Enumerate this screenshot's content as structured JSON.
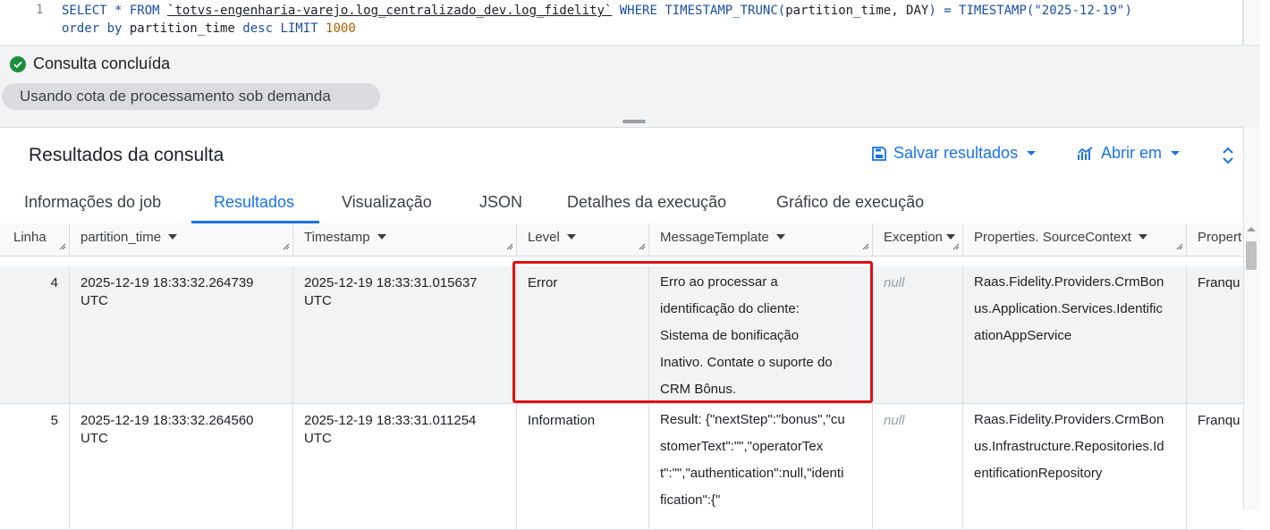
{
  "editor": {
    "line_number": "1",
    "line1": {
      "select": "SELECT * FROM ",
      "table": "`totvs-engenharia-varejo.log_centralizado_dev.log_fidelity`",
      "where": " WHERE TIMESTAMP_TRUNC(",
      "args": "partition_time, DAY",
      "eq": ") = TIMESTAMP(\"2025-12-19\")"
    },
    "line2": {
      "order": "order by ",
      "col": "partition_time",
      "desc": " desc LIMIT ",
      "limit": "1000"
    }
  },
  "status": {
    "message": "Consulta concluída",
    "quota": "Usando cota de processamento sob demanda"
  },
  "results": {
    "title": "Resultados da consulta",
    "save_label": "Salvar resultados",
    "open_label": "Abrir em"
  },
  "tabs": [
    {
      "label": "Informações do job"
    },
    {
      "label": "Resultados"
    },
    {
      "label": "Visualização"
    },
    {
      "label": "JSON"
    },
    {
      "label": "Detalhes da execução"
    },
    {
      "label": "Gráfico de execução"
    }
  ],
  "active_tab": "Resultados",
  "columns": [
    {
      "label": "Linha"
    },
    {
      "label": "partition_time"
    },
    {
      "label": "Timestamp"
    },
    {
      "label": "Level"
    },
    {
      "label": "MessageTemplate"
    },
    {
      "label": "Exception"
    },
    {
      "label": "Properties. SourceContext"
    },
    {
      "label": "Propert"
    }
  ],
  "rows": [
    {
      "line": "4",
      "partition_time": "2025-12-19 18:33:32.264739 UTC",
      "timestamp": "2025-12-19 18:33:31.015637 UTC",
      "level": "Error",
      "message": "Erro ao processar a identificação do cliente: Sistema de bonificação Inativo. Contate o suporte do CRM Bônus.",
      "exception": "null",
      "source_context": "Raas.Fidelity.Providers.CrmBonus.Application.Services.IdentificationAppService",
      "prop": "Franqu"
    },
    {
      "line": "5",
      "partition_time": "2025-12-19 18:33:32.264560 UTC",
      "timestamp": "2025-12-19 18:33:31.011254 UTC",
      "level": "Information",
      "message": "Result: {\"nextStep\":\"bonus\",\"customerText\":\"\",\"operatorText\":\"\",\"authentication\":null,\"identification\":{\"",
      "exception": "null",
      "source_context": "Raas.Fidelity.Providers.CrmBonus.Infrastructure.Repositories.IdentificationRepository",
      "prop": "Franqu"
    }
  ],
  "colors": {
    "accent": "#1a73e8",
    "success": "#1e8e3e",
    "highlight_border": "#e01010"
  }
}
